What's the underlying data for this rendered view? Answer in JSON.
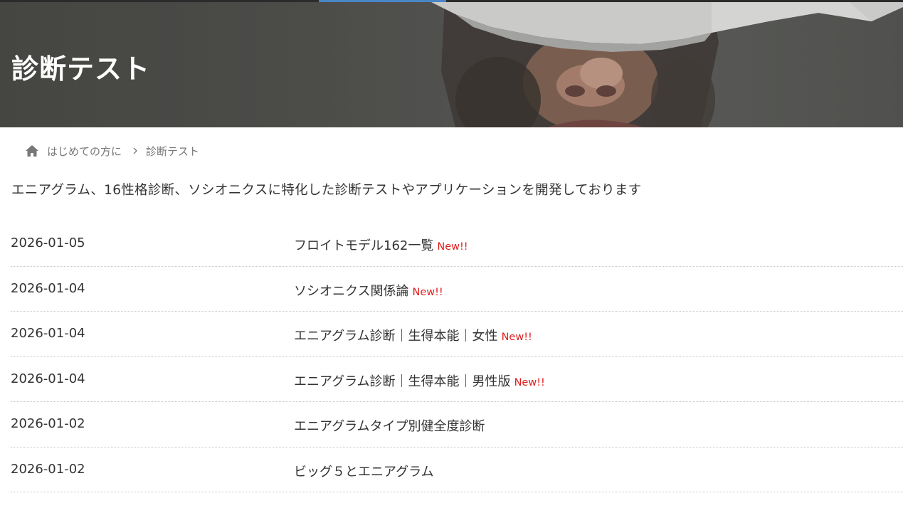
{
  "header": {
    "title": "診断テスト"
  },
  "breadcrumb": {
    "home_label": "はじめての方に",
    "current_label": "診断テスト"
  },
  "intro": {
    "text": "エニアグラム、16性格診断、ソシオニクスに特化した診断テストやアプリケーションを開発しております"
  },
  "posts": [
    {
      "date": "2026-01-05",
      "title": "フロイトモデル162一覧",
      "badge": "New!!"
    },
    {
      "date": "2026-01-04",
      "title": "ソシオニクス関係論",
      "badge": "New!!"
    },
    {
      "date": "2026-01-04",
      "title": "エニアグラム診断｜生得本能｜女性",
      "badge": "New!!"
    },
    {
      "date": "2026-01-04",
      "title": "エニアグラム診断｜生得本能｜男性版",
      "badge": "New!!"
    },
    {
      "date": "2026-01-02",
      "title": "エニアグラムタイプ別健全度診断",
      "badge": ""
    },
    {
      "date": "2026-01-02",
      "title": "ビッグ５とエニアグラム",
      "badge": ""
    }
  ],
  "colors": {
    "accent_bar": "#4a86c5",
    "new_badge": "#e02020",
    "text": "#333333",
    "muted": "#777777"
  },
  "icons": {
    "home": "home-icon",
    "separator": "chevron-right-icon"
  }
}
